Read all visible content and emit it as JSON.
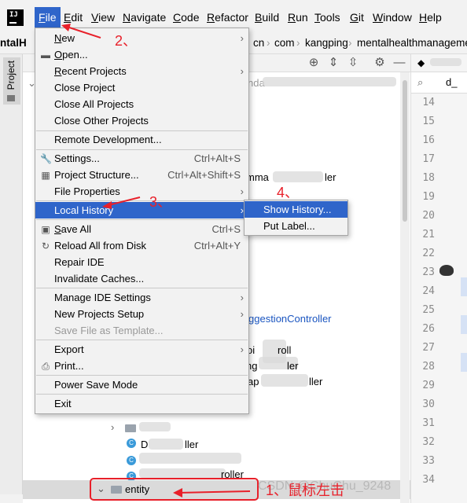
{
  "menubar": {
    "items": [
      {
        "label": "File",
        "mn": "F",
        "rest": "ile"
      },
      {
        "label": "Edit",
        "mn": "E",
        "rest": "dit"
      },
      {
        "label": "View",
        "mn": "V",
        "rest": "iew"
      },
      {
        "label": "Navigate",
        "mn": "N",
        "rest": "avigate"
      },
      {
        "label": "Code",
        "mn": "C",
        "rest": "ode"
      },
      {
        "label": "Refactor",
        "mn": "R",
        "rest": "efactor"
      },
      {
        "label": "Build",
        "mn": "B",
        "rest": "uild"
      },
      {
        "label": "Run",
        "mn": "R",
        "rest": "un"
      },
      {
        "label": "Tools",
        "mn": "T",
        "rest": "ools"
      },
      {
        "label": "Git",
        "mn": "G",
        "rest": "it"
      },
      {
        "label": "Window",
        "mn": "W",
        "rest": "indow"
      },
      {
        "label": "Help",
        "mn": "H",
        "rest": "elp"
      }
    ]
  },
  "navbar": {
    "project_fragment": "ntalH",
    "crumbs": [
      "cn",
      "com",
      "kangping",
      "mentalhealthmanageme"
    ]
  },
  "left_stripe": {
    "project_tab": "Project"
  },
  "file_menu": {
    "items": [
      {
        "label": "New",
        "mn": "N",
        "rest": "ew",
        "arrow": true
      },
      {
        "label": "Open...",
        "mn": "O",
        "rest": "pen...",
        "icon": "folder-icon"
      },
      {
        "label": "Recent Projects",
        "mn": "R",
        "rest": "ecent Projects",
        "arrow": true
      },
      {
        "label": "Close Project",
        "mn": "",
        "rest": "Close Project"
      },
      {
        "label": "Close All Projects",
        "mn": "",
        "rest": "Close All Projects"
      },
      {
        "label": "Close Other Projects",
        "mn": "",
        "rest": "Close Other Projects"
      },
      {
        "label": "Remote Development...",
        "mn": "",
        "rest": "Remote Development..."
      },
      {
        "label": "Settings...",
        "mn": "t",
        "rest": "Settings...",
        "shortcut": "Ctrl+Alt+S",
        "icon": "wrench-icon"
      },
      {
        "label": "Project Structure...",
        "mn": "",
        "rest": "Project Structure...",
        "shortcut": "Ctrl+Alt+Shift+S",
        "icon": "project-structure-icon"
      },
      {
        "label": "File Properties",
        "mn": "",
        "rest": "File Properties",
        "arrow": true
      },
      {
        "label": "Local History",
        "mn": "H",
        "rest": "Local History",
        "arrow": true,
        "highlighted": true
      },
      {
        "label": "Save All",
        "mn": "S",
        "rest": "ave All",
        "shortcut": "Ctrl+S",
        "icon": "save-icon"
      },
      {
        "label": "Reload All from Disk",
        "mn": "",
        "rest": "Reload All from Disk",
        "shortcut": "Ctrl+Alt+Y",
        "icon": "reload-icon"
      },
      {
        "label": "Repair IDE",
        "mn": "",
        "rest": "Repair IDE"
      },
      {
        "label": "Invalidate Caches...",
        "mn": "",
        "rest": "Invalidate Caches..."
      },
      {
        "label": "Manage IDE Settings",
        "mn": "",
        "rest": "Manage IDE Settings",
        "arrow": true
      },
      {
        "label": "New Projects Setup",
        "mn": "",
        "rest": "New Projects Setup",
        "arrow": true
      },
      {
        "label": "Save File as Template...",
        "mn": "",
        "rest": "Save File as Template...",
        "disabled": true
      },
      {
        "label": "Export",
        "mn": "",
        "rest": "Export",
        "arrow": true
      },
      {
        "label": "Print...",
        "mn": "P",
        "rest": "Print...",
        "icon": "print-icon"
      },
      {
        "label": "Power Save Mode",
        "mn": "",
        "rest": "Power Save Mode"
      },
      {
        "label": "Exit",
        "mn": "x",
        "rest": "Exit"
      }
    ]
  },
  "submenu": {
    "items": [
      {
        "label": "Show History..."
      },
      {
        "label": "Put Label..."
      }
    ]
  },
  "tree": {
    "fragments": [
      {
        "text": "nda"
      },
      {
        "text": "mma"
      },
      {
        "text": "ler"
      },
      {
        "text": "ggestionController"
      },
      {
        "text": "oi"
      },
      {
        "text": "roll"
      },
      {
        "text": "ng"
      },
      {
        "text": "ler"
      },
      {
        "text": "ap"
      },
      {
        "text": "ller"
      },
      {
        "text": "roller"
      },
      {
        "text": "D"
      },
      {
        "text": "ller"
      },
      {
        "text": "entity"
      }
    ]
  },
  "editor": {
    "tab_fragment": "d_",
    "line_numbers": [
      "14",
      "15",
      "16",
      "17",
      "18",
      "19",
      "20",
      "21",
      "22",
      "23",
      "24",
      "25",
      "26",
      "27",
      "28",
      "29",
      "30",
      "31",
      "32",
      "33",
      "34"
    ]
  },
  "annotations": {
    "step2": "2、",
    "step3": "3、",
    "step4": "4、",
    "step1": "1、鼠标左击"
  },
  "watermark": "CSDN @ChuChu_9248",
  "colors": {
    "highlight": "#2f65ca",
    "annotation_red": "#e8202a",
    "menu_bg": "#f2f2f2"
  }
}
